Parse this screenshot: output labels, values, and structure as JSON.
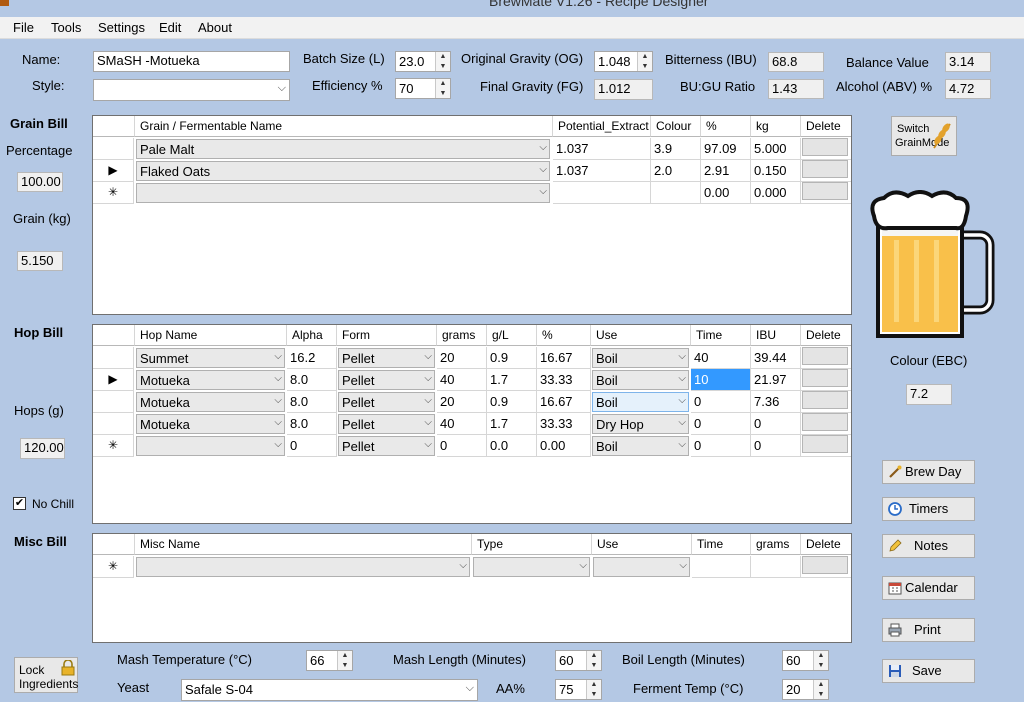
{
  "window": {
    "title": "BrewMate V1.26 - Recipe Designer"
  },
  "menu": [
    "File",
    "Tools",
    "Settings",
    "Edit",
    "About"
  ],
  "header": {
    "name_label": "Name:",
    "name_value": "SMaSH -Motueka",
    "style_label": "Style:",
    "style_value": "",
    "batch_label": "Batch Size (L)",
    "batch_value": "23.0",
    "eff_label": "Efficiency %",
    "eff_value": "70",
    "og_label": "Original Gravity (OG)",
    "og_value": "1.048",
    "fg_label": "Final Gravity (FG)",
    "fg_value": "1.012",
    "ibu_label": "Bitterness (IBU)",
    "ibu_value": "68.8",
    "bugu_label": "BU:GU Ratio",
    "bugu_value": "1.43",
    "balance_label": "Balance Value",
    "balance_value": "3.14",
    "abv_label": "Alcohol (ABV) %",
    "abv_value": "4.72"
  },
  "left": {
    "grain_title": "Grain Bill",
    "percentage_label": "Percentage",
    "percentage_value": "100.00",
    "grain_kg_label": "Grain (kg)",
    "grain_kg_value": "5.150",
    "hop_title": "Hop Bill",
    "hops_g_label": "Hops (g)",
    "hops_g_value": "120.00",
    "no_chill_label": "No Chill",
    "misc_title": "Misc Bill",
    "lock_label_1": "Lock",
    "lock_label_2": "Ingredients"
  },
  "grain_table": {
    "columns": [
      "Grain / Fermentable Name",
      "Potential_Extract",
      "Colour",
      "%",
      "kg",
      "Delete"
    ],
    "rows": [
      {
        "marker": "",
        "name": "Pale Malt",
        "extract": "1.037",
        "colour": "3.9",
        "pct": "97.09",
        "kg": "5.000"
      },
      {
        "marker": "▶",
        "name": "Flaked Oats",
        "extract": "1.037",
        "colour": "2.0",
        "pct": "2.91",
        "kg": "0.150"
      },
      {
        "marker": "✳",
        "name": "",
        "extract": "",
        "colour": "",
        "pct": "0.00",
        "kg": "0.000"
      }
    ]
  },
  "hop_table": {
    "columns": [
      "Hop Name",
      "Alpha",
      "Form",
      "grams",
      "g/L",
      "%",
      "Use",
      "Time",
      "IBU",
      "Delete"
    ],
    "rows": [
      {
        "marker": "",
        "name": "Summet",
        "alpha": "16.2",
        "form": "Pellet",
        "grams": "20",
        "gl": "0.9",
        "pct": "16.67",
        "use": "Boil",
        "time": "40",
        "ibu": "39.44"
      },
      {
        "marker": "▶",
        "name": "Motueka",
        "alpha": "8.0",
        "form": "Pellet",
        "grams": "40",
        "gl": "1.7",
        "pct": "33.33",
        "use": "Boil",
        "time": "10",
        "ibu": "21.97"
      },
      {
        "marker": "",
        "name": "Motueka",
        "alpha": "8.0",
        "form": "Pellet",
        "grams": "20",
        "gl": "0.9",
        "pct": "16.67",
        "use": "Boil",
        "time": "0",
        "ibu": "7.36"
      },
      {
        "marker": "",
        "name": "Motueka",
        "alpha": "8.0",
        "form": "Pellet",
        "grams": "40",
        "gl": "1.7",
        "pct": "33.33",
        "use": "Dry Hop",
        "time": "0",
        "ibu": "0"
      },
      {
        "marker": "✳",
        "name": "",
        "alpha": "0",
        "form": "Pellet",
        "grams": "0",
        "gl": "0.0",
        "pct": "0.00",
        "use": "Boil",
        "time": "0",
        "ibu": "0"
      }
    ]
  },
  "misc_table": {
    "columns": [
      "Misc Name",
      "Type",
      "Use",
      "Time",
      "grams",
      "Delete"
    ],
    "rows": [
      {
        "marker": "✳"
      }
    ]
  },
  "right": {
    "switch_label_1": "Switch",
    "switch_label_2": "GrainMode",
    "colour_label": "Colour (EBC)",
    "colour_value": "7.2",
    "beer_color": "#f9c04a",
    "buttons": {
      "brewday": "Brew Day",
      "timers": "Timers",
      "notes": "Notes",
      "calendar": "Calendar",
      "print": "Print",
      "save": "Save"
    }
  },
  "bottom": {
    "mash_temp_label": "Mash Temperature (°C)",
    "mash_temp_value": "66",
    "mash_len_label": "Mash Length (Minutes)",
    "mash_len_value": "60",
    "boil_len_label": "Boil Length (Minutes)",
    "boil_len_value": "60",
    "yeast_label": "Yeast",
    "yeast_value": "Safale S-04",
    "aa_label": "AA%",
    "aa_value": "75",
    "ferment_label": "Ferment Temp (°C)",
    "ferment_value": "20"
  }
}
